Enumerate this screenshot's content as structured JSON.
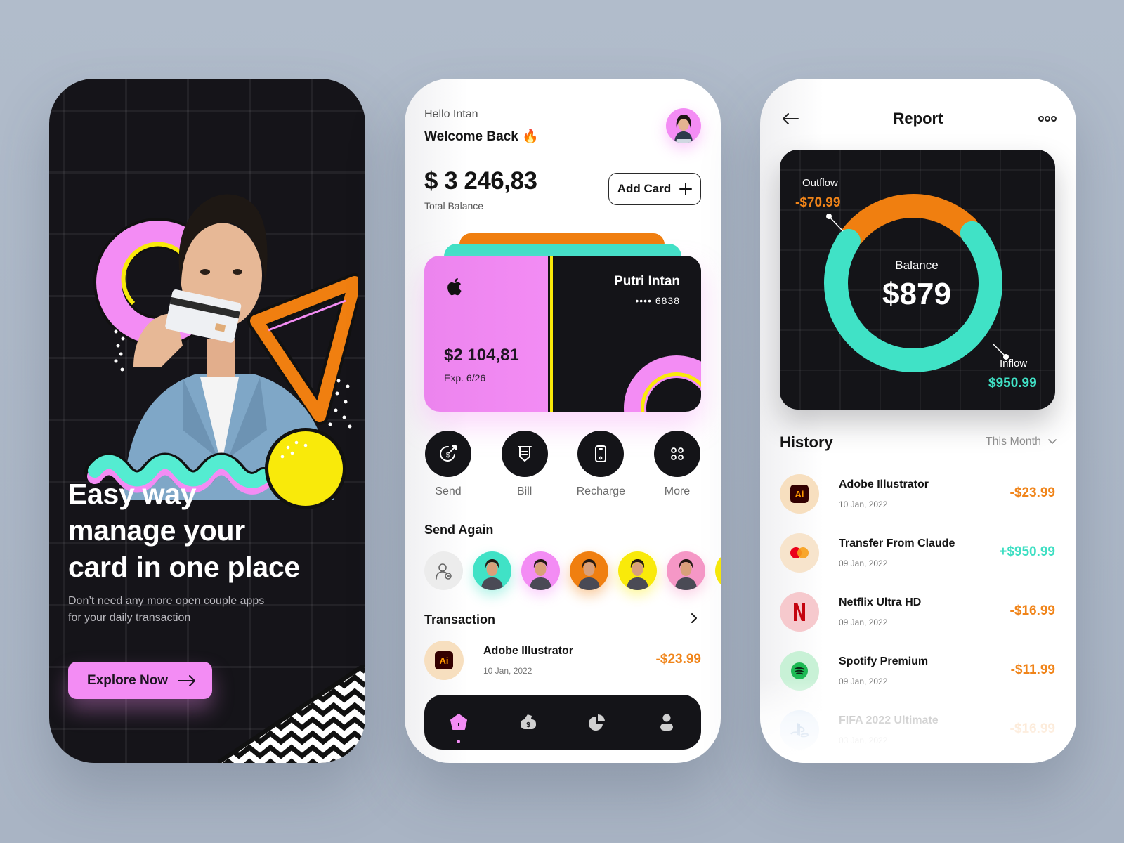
{
  "onboarding": {
    "headline": [
      "Easy way",
      "manage your",
      "card in one place"
    ],
    "subtitle": [
      "Don’t need any more open couple apps",
      "for your daily transaction"
    ],
    "cta_label": "Explore Now"
  },
  "home": {
    "greeting": "Hello Intan",
    "welcome": "Welcome Back 🔥",
    "total_balance": "$ 3 246,83",
    "total_balance_label": "Total Balance",
    "add_card_label": "Add Card",
    "card": {
      "amount": "$2 104,81",
      "expiry": "Exp. 6/26",
      "holder": "Putri Intan",
      "number": "•••• 6838"
    },
    "actions": [
      {
        "label": "Send",
        "icon": "send-money-icon"
      },
      {
        "label": "Bill",
        "icon": "bill-icon"
      },
      {
        "label": "Recharge",
        "icon": "phone-icon"
      },
      {
        "label": "More",
        "icon": "grid-dots-icon"
      }
    ],
    "send_again_title": "Send Again",
    "contacts": [
      {
        "color": "#40e2c6"
      },
      {
        "color": "#f38cf4"
      },
      {
        "color": "#f07f10"
      },
      {
        "color": "#f9ea0a"
      },
      {
        "color": "#f597c6"
      }
    ],
    "transaction_title": "Transaction",
    "transaction": {
      "name": "Adobe Illustrator",
      "date": "10 Jan, 2022",
      "amount": "-$23.99"
    },
    "nav": [
      "home-icon",
      "wallet-icon",
      "pie-chart-icon",
      "profile-icon"
    ]
  },
  "report": {
    "title": "Report",
    "history_title": "History",
    "period": "This Month",
    "history": [
      {
        "name": "Adobe Illustrator",
        "date": "10 Jan, 2022",
        "amount": "-$23.99",
        "type": "neg",
        "icon": "adobe-illustrator-icon",
        "bg": "#f7dfbf"
      },
      {
        "name": "Transfer From Claude",
        "date": "09 Jan, 2022",
        "amount": "+$950.99",
        "type": "pos",
        "icon": "mastercard-icon",
        "bg": "#f7e4cc"
      },
      {
        "name": "Netflix Ultra HD",
        "date": "09 Jan, 2022",
        "amount": "-$16.99",
        "type": "neg",
        "icon": "netflix-icon",
        "bg": "#f6c9cd"
      },
      {
        "name": "Spotify Premium",
        "date": "09 Jan, 2022",
        "amount": "-$11.99",
        "type": "neg",
        "icon": "spotify-icon",
        "bg": "#c8f1d6"
      },
      {
        "name": "FIFA 2022 Ultimate",
        "date": "03 Jan, 2022",
        "amount": "-$16.99",
        "type": "neg",
        "icon": "playstation-icon",
        "bg": "#cfe1f6"
      }
    ]
  },
  "chart_data": {
    "type": "pie",
    "title": "Balance",
    "center_value": "$879",
    "series": [
      {
        "name": "Outflow",
        "label": "-$70.99",
        "value": 70.99,
        "color": "#f07f10"
      },
      {
        "name": "Inflow",
        "label": "$950.99",
        "value": 950.99,
        "color": "#40e2c6"
      }
    ],
    "legend": "annotations"
  }
}
